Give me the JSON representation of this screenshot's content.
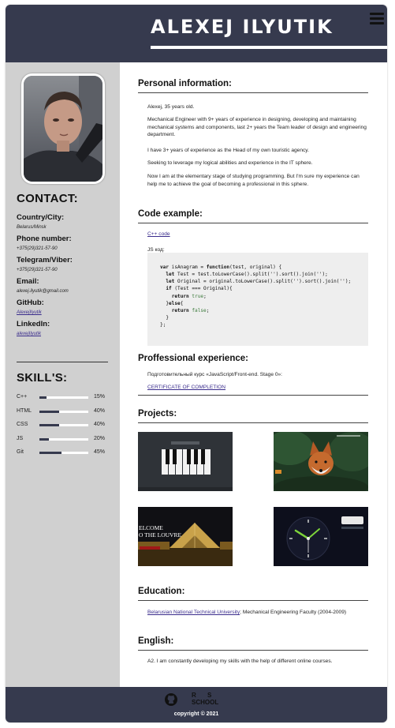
{
  "header": {
    "name": "ALEXEJ ILYUTIK",
    "menu_icon": "hamburger-icon"
  },
  "sidebar": {
    "contact_title": "CONTACT:",
    "contacts": [
      {
        "label": "Country/City:",
        "value": "Belarus/Minsk"
      },
      {
        "label": "Phone number:",
        "value": "+375(29)321-57-90"
      },
      {
        "label": "Telegram/Viber:",
        "value": "+375(29)321-57-90"
      },
      {
        "label": "Email:",
        "value": "alexej.ilyutik@gmail.com"
      },
      {
        "label": "GitHub:",
        "value": "AlexejIlyutik"
      },
      {
        "label": "LinkedIn:",
        "value": "alexejIlyutik"
      }
    ],
    "skills_title": "SKILL'S:",
    "skills": [
      {
        "name": "C++",
        "percent": "15%",
        "level": 0.15
      },
      {
        "name": "HTML",
        "percent": "40%",
        "level": 0.4
      },
      {
        "name": "CSS",
        "percent": "40%",
        "level": 0.4
      },
      {
        "name": "JS",
        "percent": "20%",
        "level": 0.2
      },
      {
        "name": "Git",
        "percent": "45%",
        "level": 0.45
      }
    ]
  },
  "main": {
    "personal": {
      "title": "Personal information:",
      "paragraphs": [
        "Alexej, 35 years old.",
        "Mechanical Engineer with 9+ years of experience in designing, developing and maintaining mechanical systems and components, last 2+ years the Team leader of design and engineering department.",
        "I have 3+ years of experience as the Head of my own touristic agency.",
        "Seeking to leverage my logical abilities and experience in the IT sphere.",
        "Now I am at the elementary stage of studying programming. But I'm sure my experience can help me to achieve the goal of becoming a professional in this sphere."
      ]
    },
    "code": {
      "title": "Code example:",
      "link": "C++ code",
      "js_label": "JS код:",
      "lines": [
        "var isAnagram = function(test, original) {",
        "  let Test = test.toLowerCase().split('').sort().join('');",
        "  let Original = original.toLowerCase().split('').sort().join('');",
        "  if (Test === Original){",
        "    return true;",
        "  }else{",
        "    return false;",
        "  }",
        "};"
      ]
    },
    "experience": {
      "title": "Proffessional experience:",
      "course": "Подготовительный курс «JavaScript/Front-end. Stage 0»:",
      "certificate_link": "CERTIFICATE OF COMPLETION"
    },
    "projects": {
      "title": "Projects:",
      "items": [
        "piano-project",
        "fox-wildlife-project",
        "louvre-project",
        "clock-project"
      ],
      "thumb_texts": {
        "louvre_1": "ELCOME",
        "louvre_2": "O THE LOUVRE"
      }
    },
    "education": {
      "title": "Education:",
      "university_link": "Belarusian National Technical University",
      "details": "; Mechanical Engineering Faculty (2004-2009)"
    },
    "english": {
      "title": "English:",
      "text": "A2. I am constantly developing my skills with the help of different online courses."
    }
  },
  "footer": {
    "copyright": "copyright © 2021",
    "github_icon": "github-icon",
    "rs_logo_1": "R",
    "rs_logo_2": "S",
    "rs_logo_3": "SCHOOL"
  },
  "colors": {
    "header_bg": "#363a4e",
    "sidebar_bg": "#d0d0d0",
    "link": "#3a2c8c"
  }
}
